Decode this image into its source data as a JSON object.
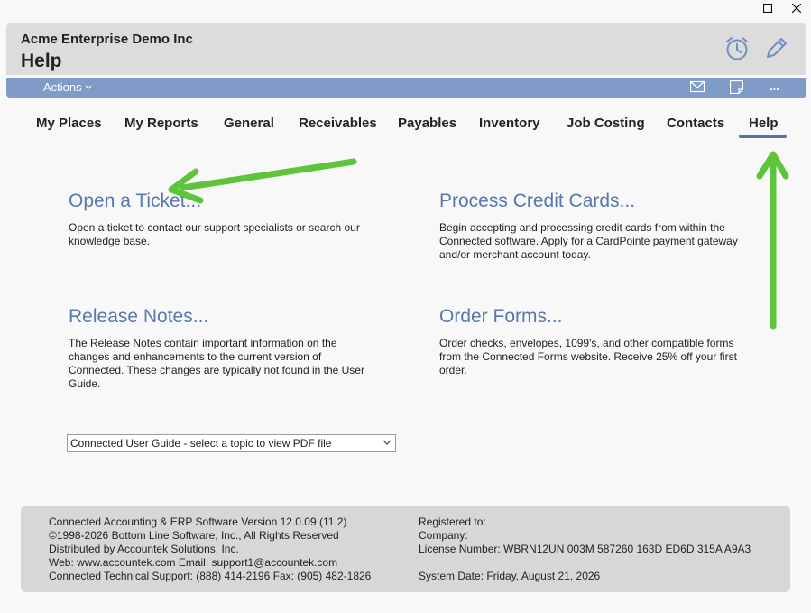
{
  "header": {
    "company": "Acme Enterprise Demo Inc",
    "module_title": "Help",
    "actions_label": "Actions",
    "more_label": "..."
  },
  "tabs": [
    {
      "label": "My Places"
    },
    {
      "label": "My Reports"
    },
    {
      "label": "General"
    },
    {
      "label": "Receivables"
    },
    {
      "label": "Payables"
    },
    {
      "label": "Inventory"
    },
    {
      "label": "Job Costing"
    },
    {
      "label": "Contacts"
    },
    {
      "label": "Help",
      "active": true
    }
  ],
  "cards": [
    {
      "title": "Open a Ticket...",
      "description": "Open a ticket to contact our support specialists or search our knowledge base."
    },
    {
      "title": "Process Credit Cards...",
      "description": "Begin accepting and processing credit cards from within the Connected software. Apply for a CardPointe payment gateway and/or merchant account today."
    },
    {
      "title": "Release Notes...",
      "description": "The Release Notes contain important information on the changes and enhancements to the current version of Connected. These changes are typically not found in the User Guide."
    },
    {
      "title": "Order Forms...",
      "description": "Order checks, envelopes, 1099's, and other compatible forms from the Connected Forms website. Receive 25% off your first order."
    }
  ],
  "guide_select": {
    "value": "Connected User Guide - select a topic to view PDF file"
  },
  "footer": {
    "left": [
      "Connected Accounting & ERP Software Version 12.0.09 (11.2)",
      "©1998-2026 Bottom Line Software, Inc., All Rights Reserved",
      "Distributed by Accountek Solutions, Inc.",
      "Web: www.accountek.com  Email: support1@accountek.com",
      "Connected Technical Support: (888) 414-2196  Fax: (905) 482-1826"
    ],
    "right": [
      "Registered to:",
      "Company:",
      "License Number: WBRN12UN 003M 587260 163D ED6D 315A A9A3",
      "",
      "System Date: Friday, August 21, 2026"
    ]
  },
  "icons": {
    "maximize": "maximize-icon",
    "close": "close-icon",
    "alarm": "alarm-clock-icon",
    "edit": "pencil-icon",
    "email": "email-icon",
    "note": "note-icon",
    "chevron": "chevron-down-icon"
  },
  "colors": {
    "header_bg": "#dcdcdc",
    "action_bar": "#7f9bc8",
    "accent": "#5472ad",
    "link_title": "#5878ad",
    "annotation_arrow": "#5ec43b",
    "footer_bg": "#d7d7d7"
  }
}
